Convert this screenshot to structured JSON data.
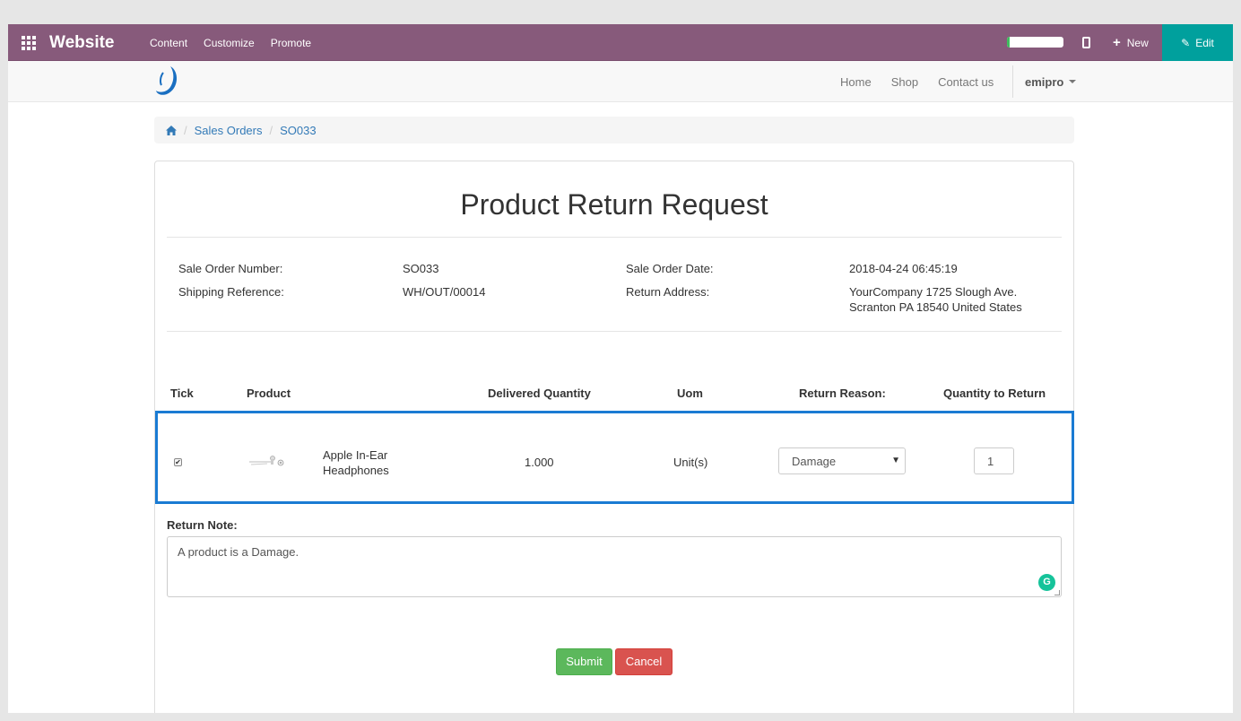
{
  "adminbar": {
    "brand": "Website",
    "menu": [
      "Content",
      "Customize",
      "Promote"
    ],
    "progress_fraction": 0.05,
    "new_label": "New",
    "edit_label": "Edit",
    "colors": {
      "bar": "#875a7b",
      "edit": "#00a09d"
    }
  },
  "navbar": {
    "links": [
      "Home",
      "Shop",
      "Contact us"
    ],
    "user": "emipro"
  },
  "breadcrumb": {
    "items": [
      "Sales Orders",
      "SO033"
    ]
  },
  "form": {
    "title": "Product Return Request",
    "info": {
      "sale_order_number_label": "Sale Order Number:",
      "sale_order_number": "SO033",
      "sale_order_date_label": "Sale Order Date:",
      "sale_order_date": "2018-04-24 06:45:19",
      "shipping_reference_label": "Shipping Reference:",
      "shipping_reference": "WH/OUT/00014",
      "return_address_label": "Return Address:",
      "return_address_line1": "YourCompany 1725 Slough Ave.",
      "return_address_line2": "Scranton PA 18540 United States"
    },
    "table": {
      "headers": [
        "Tick",
        "Product",
        "Delivered Quantity",
        "Uom",
        "Return Reason:",
        "Quantity to Return"
      ],
      "rows": [
        {
          "checked": true,
          "product_line1": "Apple In-Ear",
          "product_line2": "Headphones",
          "delivered_quantity": "1.000",
          "uom": "Unit(s)",
          "return_reason": "Damage",
          "quantity_to_return": "1"
        }
      ]
    },
    "note_label": "Return Note:",
    "note_value": "A product is a Damage.",
    "submit_label": "Submit",
    "cancel_label": "Cancel"
  }
}
